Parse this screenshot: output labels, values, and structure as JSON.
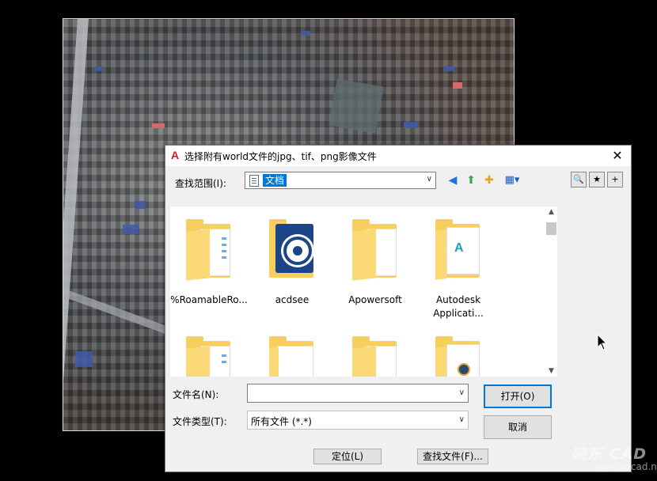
{
  "dialog": {
    "title": "选择附有world文件的jpg、tif、png影像文件",
    "app_icon": "autocad-icon",
    "close_label": "✕",
    "lookin_label": "查找范围(I):",
    "lookin_value": "文档",
    "toolbar_icons": [
      "back-icon",
      "up-folder-icon",
      "new-folder-icon",
      "view-menu-icon"
    ],
    "right_icons": [
      "search-web-icon",
      "favorites-icon",
      "add-favorites-icon"
    ]
  },
  "files": [
    {
      "label": "%RoamableRo...",
      "icon": "folder-icon"
    },
    {
      "label": "acdsee",
      "icon": "acdsee-folder-icon"
    },
    {
      "label": "Apowersoft",
      "icon": "folder-icon"
    },
    {
      "label": "Autodesk\nApplicati...",
      "icon": "autodesk-folder-icon"
    },
    {
      "label": "",
      "icon": "folder-icon"
    },
    {
      "label": "",
      "icon": "folder-icon"
    },
    {
      "label": "",
      "icon": "folder-icon"
    },
    {
      "label": "",
      "icon": "davinci-folder-icon"
    }
  ],
  "filename": {
    "label": "文件名(N):",
    "value": ""
  },
  "filetype": {
    "label": "文件类型(T):",
    "value": "所有文件 (*.*)"
  },
  "buttons": {
    "open": "打开(O)",
    "cancel": "取消",
    "locate": "定位(L)",
    "find": "查找文件(F)..."
  },
  "watermark": {
    "line1": "晓东 CAD",
    "line2": "www.xdcad.net"
  }
}
